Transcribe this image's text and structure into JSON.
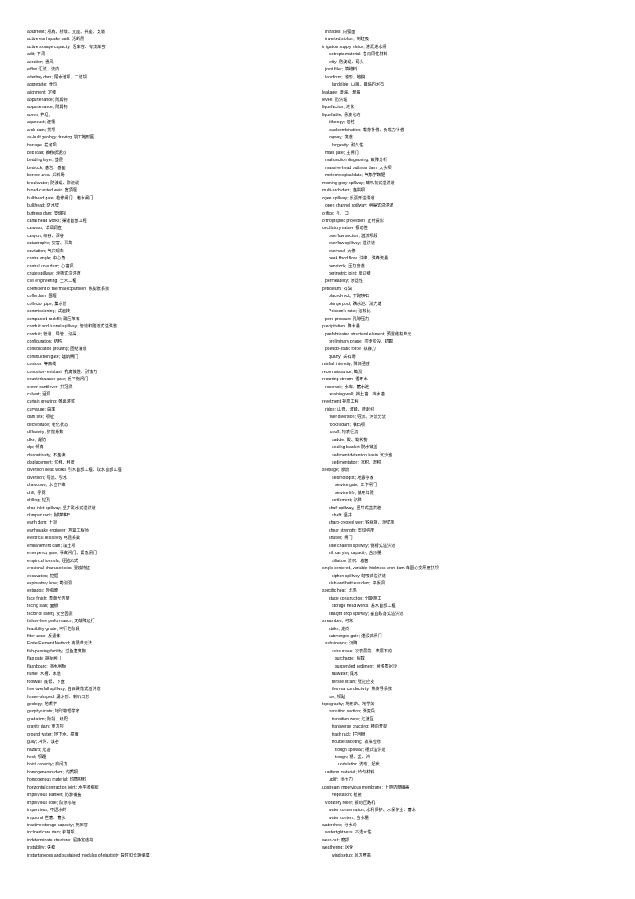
{
  "document": {
    "title": "English-Chinese Glossary of Dam and Hydraulic Engineering Terms",
    "columns": 2
  },
  "left_column": [
    {
      "en": "abutment;",
      "zh": "坝肩、桥墩、支座、拱座、支墩",
      "indent": 0
    },
    {
      "en": "active earthquake  fault;",
      "zh": "活断层",
      "indent": 0
    },
    {
      "en": "active storage capacity;",
      "zh": "活库容、有效库容",
      "indent": 0
    },
    {
      "en": "adit;",
      "zh": "平洞",
      "indent": 0
    },
    {
      "en": "aeration;",
      "zh": "通风",
      "indent": 0
    },
    {
      "en": "efflux",
      "zh": "汇流、流向",
      "indent": 0
    },
    {
      "en": "afterbay dam;",
      "zh": "尾水池坝、二道坝",
      "indent": 0
    },
    {
      "en": "aggregate;",
      "zh": "骨料",
      "indent": 0
    },
    {
      "en": "alignment;",
      "zh": "定线",
      "indent": 0
    },
    {
      "en": "appurtenance;",
      "zh": "附属物",
      "indent": 0
    },
    {
      "en": "appurtenance;",
      "zh": "附属物",
      "indent": 0
    },
    {
      "en": "apron; 护坦;",
      "zh": "",
      "indent": 0
    },
    {
      "en": "aqueduct;",
      "zh": "渡槽",
      "indent": 0
    },
    {
      "en": "arch dam;",
      "zh": "拱坝",
      "indent": 0
    },
    {
      "en": "as-built  geology  drawing",
      "zh": "竣工地形图",
      "indent": 0
    },
    {
      "en": "barrage;",
      "zh": "拦河坝",
      "indent": 0
    },
    {
      "en": "bed load;",
      "zh": "推移质泥沙",
      "indent": 0
    },
    {
      "en": "bedding  layer;",
      "zh": "垫层",
      "indent": 0
    },
    {
      "en": "bedrock;",
      "zh": "基岩、基面",
      "indent": 0
    },
    {
      "en": "borrow area;",
      "zh": "采料场",
      "indent": 0
    },
    {
      "en": "breakwater;",
      "zh": "防波堤、防浪堤",
      "indent": 0
    },
    {
      "en": "broad-crested weir;",
      "zh": "宽顶堰",
      "indent": 0
    },
    {
      "en": "bulkhead  gate;",
      "zh": "检修闸门、堵水闸门",
      "indent": 0
    },
    {
      "en": "bulkhead;",
      "zh": "防水壁",
      "indent": 0
    },
    {
      "en": "buttress dam;",
      "zh": "支墩坝",
      "indent": 0
    },
    {
      "en": "canal head works;",
      "zh": "渠道首部工程",
      "indent": 0
    },
    {
      "en": "canvass;",
      "zh": "详细调查",
      "indent": 0
    },
    {
      "en": "canyon;",
      "zh": "峡谷、深谷",
      "indent": 0
    },
    {
      "en": "catastrophe;",
      "zh": "灾害、事故",
      "indent": 0
    },
    {
      "en": "cavitation;",
      "zh": "气穴现象",
      "indent": 0
    },
    {
      "en": "centre angle;",
      "zh": "中心角",
      "indent": 0
    },
    {
      "en": "central core dam;",
      "zh": "心墙坝",
      "indent": 0
    },
    {
      "en": "chute spillway;",
      "zh": "滑槽式溢洪道",
      "indent": 0
    },
    {
      "en": "civil engineering;",
      "zh": "土木工程",
      "indent": 0
    },
    {
      "en": "coefficient of thermal expansion;",
      "zh": "热膨胀系数",
      "indent": 0
    },
    {
      "en": "cofferdam;",
      "zh": "围堰",
      "indent": 0
    },
    {
      "en": "collector pipe;",
      "zh": "集水管",
      "indent": 0
    },
    {
      "en": "commissioning;",
      "zh": "试运转",
      "indent": 0
    },
    {
      "en": "compacted rockfill;",
      "zh": "碾压堆石",
      "indent": 0
    },
    {
      "en": "conduit and tunnel spillway;",
      "zh": "管道和隧道式溢洪道",
      "indent": 0
    },
    {
      "en": "conduit;",
      "zh": "管道、导管、沟渠、",
      "indent": 0
    },
    {
      "en": "configuration;",
      "zh": "结构",
      "indent": 0
    },
    {
      "en": "consolidation  grouting;",
      "zh": "固结灌浆",
      "indent": 0
    },
    {
      "en": "construction gate;",
      "zh": "建筑闸门",
      "indent": 0
    },
    {
      "en": "contour;",
      "zh": "等高线",
      "indent": 0
    },
    {
      "en": "corrosion-resistant;",
      "zh": "抗腐蚀性、耐蚀力",
      "indent": 0
    },
    {
      "en": "counterbalance  gate;",
      "zh": "反平衡闸门",
      "indent": 0
    },
    {
      "en": "crown cantilever;",
      "zh": "拱冠梁",
      "indent": 0
    },
    {
      "en": "culvert;",
      "zh": "涵洞",
      "indent": 0
    },
    {
      "en": "curtain grouting;",
      "zh": "帷幕灌浆",
      "indent": 0
    },
    {
      "en": "curvature;",
      "zh": "曲率",
      "indent": 0
    },
    {
      "en": "dam site;",
      "zh": "坝址",
      "indent": 0
    },
    {
      "en": "decrepitude;",
      "zh": "老化状态",
      "indent": 0
    },
    {
      "en": "diffusivity;",
      "zh": "扩散系数",
      "indent": 0
    },
    {
      "en": "dike;",
      "zh": "堤防",
      "indent": 0
    },
    {
      "en": "dip;",
      "zh": "倾角",
      "indent": 0
    },
    {
      "en": "discontinuity;",
      "zh": "不连续",
      "indent": 0
    },
    {
      "en": "displacement;",
      "zh": "位移、移置",
      "indent": 0
    },
    {
      "en": "diversion  head works",
      "zh": "引水首部工程、取水首部工程",
      "indent": 0
    },
    {
      "en": "diversion;",
      "zh": "导流、引水",
      "indent": 0
    },
    {
      "en": "drawdown;",
      "zh": "水位下降",
      "indent": 0
    },
    {
      "en": "drift;",
      "zh": "导洞",
      "indent": 0
    },
    {
      "en": "drilling;",
      "zh": "钻孔",
      "indent": 0
    },
    {
      "en": "drop  inlet spillway;",
      "zh": "竖井跌水式溢洪道",
      "indent": 0
    },
    {
      "en": "dumped rock;",
      "zh": "抛填堆石",
      "indent": 0
    },
    {
      "en": "earth dam;",
      "zh": "土坝",
      "indent": 0
    },
    {
      "en": "earthquake  engineer;",
      "zh": "地震工程师",
      "indent": 0
    },
    {
      "en": "electrical  resistivity",
      "zh": "电阻系数",
      "indent": 0
    },
    {
      "en": "embankment dam;",
      "zh": "填土坝",
      "indent": 0
    },
    {
      "en": "emergency gate;",
      "zh": "事故闸门、紧急闸门",
      "indent": 0
    },
    {
      "en": "empirical  formula;",
      "zh": "经验公式",
      "indent": 0
    },
    {
      "en": "erosional  characteristics",
      "zh": "侵蚀特征",
      "indent": 0
    },
    {
      "en": "excavation;",
      "zh": "挖掘",
      "indent": 0
    },
    {
      "en": "exploratory  hole;",
      "zh": "勘测洞",
      "indent": 0
    },
    {
      "en": "extrados;",
      "zh": "外弧面",
      "indent": 0
    },
    {
      "en": "face finish;",
      "zh": "表面光洁度",
      "indent": 0
    },
    {
      "en": "facing  slab;",
      "zh": "面板",
      "indent": 0
    },
    {
      "en": "factor of safety",
      "zh": "安全因素",
      "indent": 0
    },
    {
      "en": "failure-free  performance;",
      "zh": "无故障运行",
      "indent": 0
    },
    {
      "en": "feasibility-grade;",
      "zh": "可行性阶段",
      "indent": 0
    },
    {
      "en": "filter zone;",
      "zh": "反滤体",
      "indent": 0
    },
    {
      "en": "Finite Element  Method;",
      "zh": "有限单元法",
      "indent": 0
    },
    {
      "en": "fish-passing  facility;",
      "zh": "过鱼建筑物",
      "indent": 0
    },
    {
      "en": "flap gate",
      "zh": "翻板闸门",
      "indent": 0
    },
    {
      "en": "flashboard;",
      "zh": "挡水闸板",
      "indent": 0
    },
    {
      "en": "flume;",
      "zh": "水槽、水道",
      "indent": 0
    },
    {
      "en": "footwall;",
      "zh": "底帮、下盘",
      "indent": 0
    },
    {
      "en": "free overfall  spillway;",
      "zh": "自由跌落式溢洪道",
      "indent": 0
    },
    {
      "en": "funnel-shaped;",
      "zh": "漏斗形、喇叭口形",
      "indent": 0
    },
    {
      "en": "geology;",
      "zh": "地质学",
      "indent": 0
    },
    {
      "en": "geophysicists;",
      "zh": "地球物理学家",
      "indent": 0
    },
    {
      "en": "gradation;",
      "zh": "阶段、级配",
      "indent": 0
    },
    {
      "en": "gravity dam;",
      "zh": "重力坝",
      "indent": 0
    },
    {
      "en": "ground  water;",
      "zh": "地下水、基面",
      "indent": 0
    },
    {
      "en": "gully;",
      "zh": "冲沟、溪谷",
      "indent": 0
    },
    {
      "en": "hazard;",
      "zh": "危害",
      "indent": 0
    },
    {
      "en": "heel;",
      "zh": "坝踵",
      "indent": 0
    },
    {
      "en": "hoist capacity;",
      "zh": "启闭力",
      "indent": 0
    },
    {
      "en": "homogeneous  dam;",
      "zh": "均质坝",
      "indent": 0
    },
    {
      "en": "homogenous  material;",
      "zh": "均质材料",
      "indent": 0
    },
    {
      "en": "horizontal  contraction  joint;",
      "zh": "水平收缩缝",
      "indent": 0
    },
    {
      "en": "impervious  blanket;",
      "zh": "防渗铺盖",
      "indent": 0
    },
    {
      "en": "impervious  core;",
      "zh": "防渗心墙",
      "indent": 0
    },
    {
      "en": "impervious;",
      "zh": "不透水的",
      "indent": 0
    },
    {
      "en": "impound",
      "zh": "拦蓄、蓄水",
      "indent": 0
    },
    {
      "en": "inactive  storage  capacity;",
      "zh": "死库容",
      "indent": 0
    },
    {
      "en": "inclined  core dam;",
      "zh": "斜墙坝",
      "indent": 0
    },
    {
      "en": "indeterminate  structure;",
      "zh": "超静定结构",
      "indent": 0
    },
    {
      "en": "instability;",
      "zh": "失稳",
      "indent": 0
    },
    {
      "en": "instantaneous  and  sustained  modulus  of  elasticity",
      "zh": "瞬时和长期弹模",
      "indent": 0
    }
  ],
  "right_column": [
    {
      "en": "intrados;",
      "zh": "内弧面",
      "indent": 1
    },
    {
      "en": "inverted siphon;",
      "zh": "倒虹吸",
      "indent": 1
    },
    {
      "en": "irrigation  supply  sluice;",
      "zh": "灌溉进水闸",
      "indent": 0
    },
    {
      "en": "isotropic material;",
      "zh": "各向同性材料",
      "indent": 2
    },
    {
      "en": "jetty;",
      "zh": "防波堤、码头",
      "indent": 2
    },
    {
      "en": "joint filler;",
      "zh": "填缝料",
      "indent": 1
    },
    {
      "en": "landform;",
      "zh": "地形、地貌",
      "indent": 1
    },
    {
      "en": "landslide;",
      "zh": "山崩、崩塌的泥石",
      "indent": 3
    },
    {
      "en": "leakage;",
      "zh": "渗漏、渗漏",
      "indent": 0
    },
    {
      "en": "levee;",
      "zh": "防洪堤",
      "indent": 0
    },
    {
      "en": "liquefaction;",
      "zh": "液化",
      "indent": 0
    },
    {
      "en": "liquefiable;",
      "zh": "易液化的",
      "indent": 0
    },
    {
      "en": "lithology;",
      "zh": "岩性",
      "indent": 2
    },
    {
      "en": "load combination;",
      "zh": "载荷补偿、负载力补偿",
      "indent": 2
    },
    {
      "en": "logway;",
      "zh": "筏道",
      "indent": 2
    },
    {
      "en": "longevity;",
      "zh": "耐久性",
      "indent": 3
    },
    {
      "en": "main gate;",
      "zh": "主闸门",
      "indent": 1
    },
    {
      "en": "malfunction diagnosing;",
      "zh": "故障分析",
      "indent": 1
    },
    {
      "en": "massive-head  buttress  dam;",
      "zh": "大头坝",
      "indent": 1
    },
    {
      "en": "meteorological data;",
      "zh": "气象学数据",
      "indent": 1
    },
    {
      "en": "morning  glory spillway;",
      "zh": "喇叭花式溢洪道",
      "indent": 0
    },
    {
      "en": "multi-arch  dam;",
      "zh": "连拱坝",
      "indent": 0
    },
    {
      "en": "ogee spillway;",
      "zh": "反弧形溢洪道",
      "indent": 0
    },
    {
      "en": "open channel spillway;",
      "zh": "明渠式溢洪道",
      "indent": 1
    },
    {
      "en": "orifice;",
      "zh": "孔、口",
      "indent": 0
    },
    {
      "en": "orthographic  projection;",
      "zh": "正射投影",
      "indent": 0
    },
    {
      "en": "oscillatory  nature",
      "zh": "振动性",
      "indent": 0
    },
    {
      "en": "overflow section;",
      "zh": "溢流坝段",
      "indent": 2
    },
    {
      "en": "overflow spillway;",
      "zh": "溢洪道",
      "indent": 2
    },
    {
      "en": "overhaul;",
      "zh": "大修",
      "indent": 2
    },
    {
      "en": "peak flood flow;",
      "zh": "洪峰、洪峰流量",
      "indent": 2
    },
    {
      "en": "penstock;",
      "zh": "压力管道",
      "indent": 2
    },
    {
      "en": "perimetric joint;",
      "zh": "周边缝",
      "indent": 2
    },
    {
      "en": "permeability;",
      "zh": "渗透性",
      "indent": 1
    },
    {
      "en": "petroleum;",
      "zh": "石油",
      "indent": 0
    },
    {
      "en": "placed-rock;",
      "zh": "干砌块石",
      "indent": 2
    },
    {
      "en": "plunge pool;",
      "zh": "跌水池、消力塘",
      "indent": 2
    },
    {
      "en": "Poisson's ratio;",
      "zh": "泊松比",
      "indent": 2
    },
    {
      "en": "pore  pressure",
      "zh": "孔隙压力",
      "indent": 1
    },
    {
      "en": "precipitation;",
      "zh": "降水量",
      "indent": 0
    },
    {
      "en": "prefabricated structural element;",
      "zh": "预置结构单元",
      "indent": 1
    },
    {
      "en": "preliminary  phase;",
      "zh": "初步阶段、初勘",
      "indent": 2
    },
    {
      "en": "pseudo-static  force;",
      "zh": "拟静力",
      "indent": 1
    },
    {
      "en": "quarry;",
      "zh": "采石场",
      "indent": 2
    },
    {
      "en": "rainfall intensity;",
      "zh": "降雨强度",
      "indent": 0
    },
    {
      "en": "reconnaissance;",
      "zh": "勘测",
      "indent": 0
    },
    {
      "en": "recurring  stream;",
      "zh": "循环水",
      "indent": 0
    },
    {
      "en": "reservoir;",
      "zh": "水库、蓄水池",
      "indent": 1
    },
    {
      "en": "retaining wall;",
      "zh": "挡土墙、挡水墙",
      "indent": 2
    },
    {
      "en": "revetment",
      "zh": "护岸工程",
      "indent": 0
    },
    {
      "en": "ridge;",
      "zh": "山脊、波峰、隆起线",
      "indent": 1
    },
    {
      "en": "river diversion;",
      "zh": "导流、河流分流",
      "indent": 2
    },
    {
      "en": "rockfill dam;",
      "zh": "堆石坝",
      "indent": 2
    },
    {
      "en": "runoff;",
      "zh": "地表径流",
      "indent": 2
    },
    {
      "en": "saddle;",
      "zh": "鞍、鞍状物",
      "indent": 3
    },
    {
      "en": "sealing blanket",
      "zh": "防水铺盖",
      "indent": 3
    },
    {
      "en": "sediment detention basin",
      "zh": "沉沙池",
      "indent": 3
    },
    {
      "en": "sedimentation;",
      "zh": "沉积、淤积",
      "indent": 3
    },
    {
      "en": "seepage;",
      "zh": "渗流",
      "indent": 0
    },
    {
      "en": "seismologist;",
      "zh": "地震学家",
      "indent": 3
    },
    {
      "en": "service gate;",
      "zh": "工作闸门",
      "indent": 4
    },
    {
      "en": "service life;",
      "zh": "使用年限",
      "indent": 4
    },
    {
      "en": "settlement;",
      "zh": "沉降",
      "indent": 3
    },
    {
      "en": "shaft spillway;",
      "zh": "竖井式溢洪道",
      "indent": 2
    },
    {
      "en": "shaft;",
      "zh": "竖井",
      "indent": 3
    },
    {
      "en": "sharp-crested weir;",
      "zh": "锐缘堰、薄壁堰",
      "indent": 2
    },
    {
      "en": "shear strength;",
      "zh": "剪切强度",
      "indent": 2
    },
    {
      "en": "shutter;",
      "zh": "闸门",
      "indent": 2
    },
    {
      "en": "side channel spillway;",
      "zh": "侧槽式溢洪道",
      "indent": 2
    },
    {
      "en": "silt carrying capacity;",
      "zh": "含沙量",
      "indent": 2
    },
    {
      "en": "siltation",
      "zh": "淤积、堵塞",
      "indent": 3
    },
    {
      "en": "single  centered,  variable  thickness  arch  dam",
      "zh": "单圆心变厚度拱坝",
      "indent": 0
    },
    {
      "en": "siphon spillway",
      "zh": "虹吸式溢洪道",
      "indent": 3
    },
    {
      "en": "slab and buttress dam;",
      "zh": "平板坝",
      "indent": 2
    },
    {
      "en": "specific heat;",
      "zh": "比热",
      "indent": 0
    },
    {
      "en": "stage construction;",
      "zh": "分期施工",
      "indent": 2
    },
    {
      "en": "storage head works;",
      "zh": "蓄水首部工程",
      "indent": 3
    },
    {
      "en": "straight drop spillway;",
      "zh": "垂直跌落式溢洪道",
      "indent": 2
    },
    {
      "en": "streambed;",
      "zh": "河床",
      "indent": 0
    },
    {
      "en": "strike;",
      "zh": "走向",
      "indent": 2
    },
    {
      "en": "submerged gate;",
      "zh": "潜没式闸门",
      "indent": 2
    },
    {
      "en": "subsidence;",
      "zh": "沉降",
      "indent": 1
    },
    {
      "en": "subsurface;",
      "zh": "次表层的、表层下的",
      "indent": 3
    },
    {
      "en": "surcharge;",
      "zh": "超载",
      "indent": 4
    },
    {
      "en": "suspended sediment;",
      "zh": "悬移质泥沙",
      "indent": 4
    },
    {
      "en": "tailwater;",
      "zh": "尾水",
      "indent": 3
    },
    {
      "en": "tensile strain;",
      "zh": "张拉应变",
      "indent": 3
    },
    {
      "en": "thermal conductivity;",
      "zh": "热传导系数",
      "indent": 3
    },
    {
      "en": "toe;",
      "zh": "坝趾",
      "indent": 2
    },
    {
      "en": "topography;",
      "zh": "地形的、地学的",
      "indent": 0
    },
    {
      "en": "transition section;",
      "zh": "渐变段",
      "indent": 2
    },
    {
      "en": "transition zone;",
      "zh": "过渡区",
      "indent": 3
    },
    {
      "en": "transverse cracking;",
      "zh": "横向开裂",
      "indent": 3
    },
    {
      "en": "trash rack;",
      "zh": "拦污栅",
      "indent": 3
    },
    {
      "en": "trouble shooting;",
      "zh": "故障检修",
      "indent": 3
    },
    {
      "en": "trough spillway;",
      "zh": "槽式溢洪道",
      "indent": 4
    },
    {
      "en": "trough;",
      "zh": "槽、盆、沟",
      "indent": 4
    },
    {
      "en": "undulation",
      "zh": "波动、起伏",
      "indent": 5
    },
    {
      "en": "uniform material;",
      "zh": "均匀材料",
      "indent": 1
    },
    {
      "en": "uplift;",
      "zh": "扬压力",
      "indent": 2
    },
    {
      "en": "upstream  impervious  membrane;",
      "zh": "上游防渗铺盖",
      "indent": 0
    },
    {
      "en": "vegetation;",
      "zh": "植被",
      "indent": 3
    },
    {
      "en": "vibratory roller;",
      "zh": "振动压路机",
      "indent": 1
    },
    {
      "en": "water conservation;",
      "zh": "水利保护、水保作业：蓄水",
      "indent": 2
    },
    {
      "en": "water content;",
      "zh": "含水量",
      "indent": 2
    },
    {
      "en": "watershed;",
      "zh": "分水岭",
      "indent": 0
    },
    {
      "en": "watertightness;",
      "zh": "不透水性",
      "indent": 1
    },
    {
      "en": "wear-out;",
      "zh": "磨损",
      "indent": 0
    },
    {
      "en": "weathering;",
      "zh": "风化",
      "indent": 0
    },
    {
      "en": "wind setup;",
      "zh": "风力壅高",
      "indent": 3
    }
  ]
}
